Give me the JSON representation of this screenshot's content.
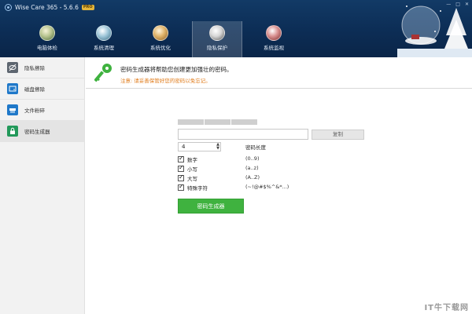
{
  "app": {
    "title": "Wise Care 365 - 5.6.6",
    "badge": "PRO"
  },
  "nav": {
    "tabs": [
      {
        "label": "电脑体检",
        "icon": "checkup-icon"
      },
      {
        "label": "系统清理",
        "icon": "clean-icon"
      },
      {
        "label": "系统优化",
        "icon": "optimize-icon"
      },
      {
        "label": "隐私保护",
        "icon": "privacy-icon",
        "active": true
      },
      {
        "label": "系统监视",
        "icon": "monitor-icon"
      }
    ]
  },
  "sidebar": {
    "items": [
      {
        "label": "隐私擦除",
        "icon": "eye-slash-icon"
      },
      {
        "label": "磁盘擦除",
        "icon": "disk-icon"
      },
      {
        "label": "文件粉碎",
        "icon": "shredder-icon"
      },
      {
        "label": "密码生成器",
        "icon": "lock-icon",
        "active": true
      }
    ]
  },
  "main": {
    "banner": {
      "title": "密码生成器将帮助您创建更加强壮的密码。",
      "note": "注意: 请妥善保管好您的密码以免忘记。"
    },
    "generator": {
      "password_value": "",
      "copy_label": "复制",
      "length_value": "4",
      "length_label": "密码长度",
      "options": [
        {
          "label": "数字",
          "range": "(0..9)",
          "checked": true
        },
        {
          "label": "小写",
          "range": "(a..z)",
          "checked": true
        },
        {
          "label": "大写",
          "range": "(A..Z)",
          "checked": true
        },
        {
          "label": "特殊字符",
          "range": "(~!@#$%^&*...)",
          "checked": true
        }
      ],
      "generate_label": "密码生成器"
    }
  },
  "watermark": "IT牛下载网",
  "colors": {
    "header_bg": "#0c2d55",
    "accent_green": "#3fb23f",
    "note_orange": "#e07b1a"
  }
}
